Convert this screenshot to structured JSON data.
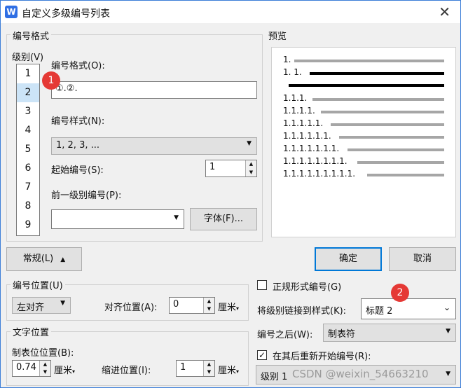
{
  "window": {
    "title": "自定义多级编号列表",
    "app_icon": "W"
  },
  "number_format_group": {
    "label": "编号格式",
    "level_label": "级别(V)",
    "levels": [
      "1",
      "2",
      "3",
      "4",
      "5",
      "6",
      "7",
      "8",
      "9"
    ],
    "selected_level": "2",
    "format_label": "编号格式(O):",
    "format_value": "①.②.",
    "style_label": "编号样式(N):",
    "style_value": "1, 2, 3, ...",
    "start_label": "起始编号(S):",
    "start_value": "1",
    "prev_level_label": "前一级别编号(P):",
    "prev_level_value": "",
    "font_button": "字体(F)..."
  },
  "preview": {
    "label": "预览",
    "rows": [
      "1.",
      "1. 1.",
      "",
      "1.1.1.",
      "1.1.1.1.",
      "1.1.1.1.1.",
      "1.1.1.1.1.1.",
      "1.1.1.1.1.1.1.",
      "1.1.1.1.1.1.1.1.",
      "1.1.1.1.1.1.1.1.1."
    ]
  },
  "buttons": {
    "general": "常规(L)",
    "ok": "确定",
    "cancel": "取消"
  },
  "number_position": {
    "label": "编号位置(U)",
    "align_value": "左对齐",
    "align_pos_label": "对齐位置(A):",
    "align_pos_value": "0",
    "unit": "厘米"
  },
  "text_position": {
    "label": "文字位置",
    "tab_label": "制表位位置(B):",
    "tab_value": "0.74",
    "indent_label": "缩进位置(I):",
    "indent_value": "1",
    "unit": "厘米"
  },
  "options": {
    "legal_style_label": "正规形式编号(G)",
    "legal_style_checked": false,
    "link_style_label": "将级别链接到样式(K):",
    "link_style_value": "标题 2",
    "after_number_label": "编号之后(W):",
    "after_number_value": "制表符",
    "restart_label": "在其后重新开始编号(R):",
    "restart_checked": true,
    "restart_value": "级别 1"
  },
  "badges": [
    "1",
    "2"
  ],
  "watermark": "CSDN @weixin_54663210"
}
